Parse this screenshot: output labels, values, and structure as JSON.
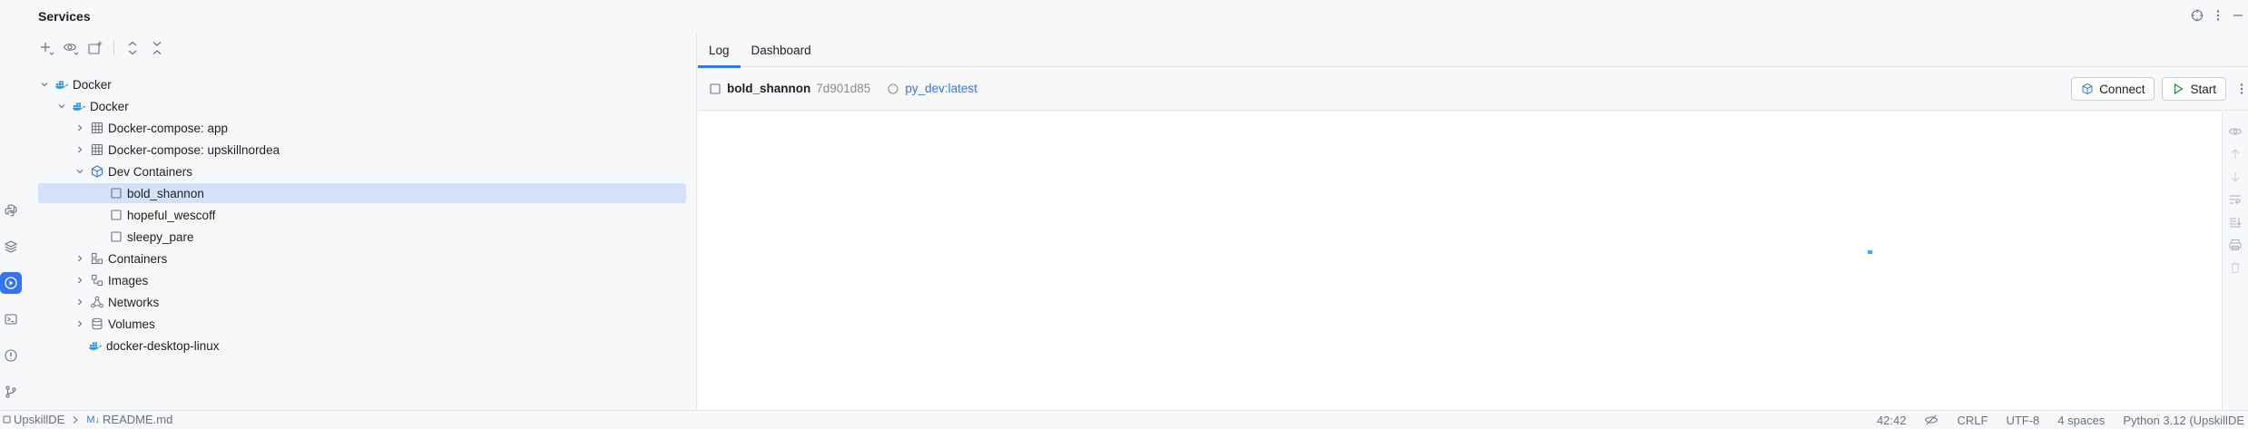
{
  "window": {
    "title": "Services"
  },
  "tree": {
    "items": [
      {
        "label": "Docker",
        "expanded": true,
        "icon": "docker-icon"
      },
      {
        "label": "Docker",
        "expanded": true,
        "icon": "docker-icon"
      },
      {
        "label": "Docker-compose: app",
        "expanded": false,
        "icon": "compose-icon"
      },
      {
        "label": "Docker-compose: upskillnordea",
        "expanded": false,
        "icon": "compose-icon"
      },
      {
        "label": "Dev Containers",
        "expanded": true,
        "icon": "dev-containers-icon"
      },
      {
        "label": "bold_shannon",
        "selected": true,
        "icon": "container-icon"
      },
      {
        "label": "hopeful_wescoff",
        "icon": "container-icon"
      },
      {
        "label": "sleepy_pare",
        "icon": "container-icon"
      },
      {
        "label": "Containers",
        "expanded": false,
        "icon": "containers-icon"
      },
      {
        "label": "Images",
        "expanded": false,
        "icon": "images-icon"
      },
      {
        "label": "Networks",
        "expanded": false,
        "icon": "networks-icon"
      },
      {
        "label": "Volumes",
        "expanded": false,
        "icon": "volumes-icon"
      },
      {
        "label": "docker-desktop-linux",
        "icon": "docker-icon"
      }
    ]
  },
  "detail": {
    "tabs": [
      {
        "label": "Log",
        "active": true
      },
      {
        "label": "Dashboard",
        "active": false
      }
    ],
    "container_name": "bold_shannon",
    "container_id": "7d901d85",
    "image": "py_dev:latest",
    "connect_label": "Connect",
    "start_label": "Start"
  },
  "status": {
    "breadcrumb_project": "UpskillDE",
    "breadcrumb_file": "README.md",
    "breadcrumb_file_prefix": "M↓",
    "position": "42:42",
    "line_ending": "CRLF",
    "encoding": "UTF-8",
    "indent": "4 spaces",
    "interpreter": "Python 3.12 (UpskillDE"
  },
  "colors": {
    "accent": "#3574f0",
    "selection": "#d5e1fb",
    "docker": "#2496ed"
  }
}
